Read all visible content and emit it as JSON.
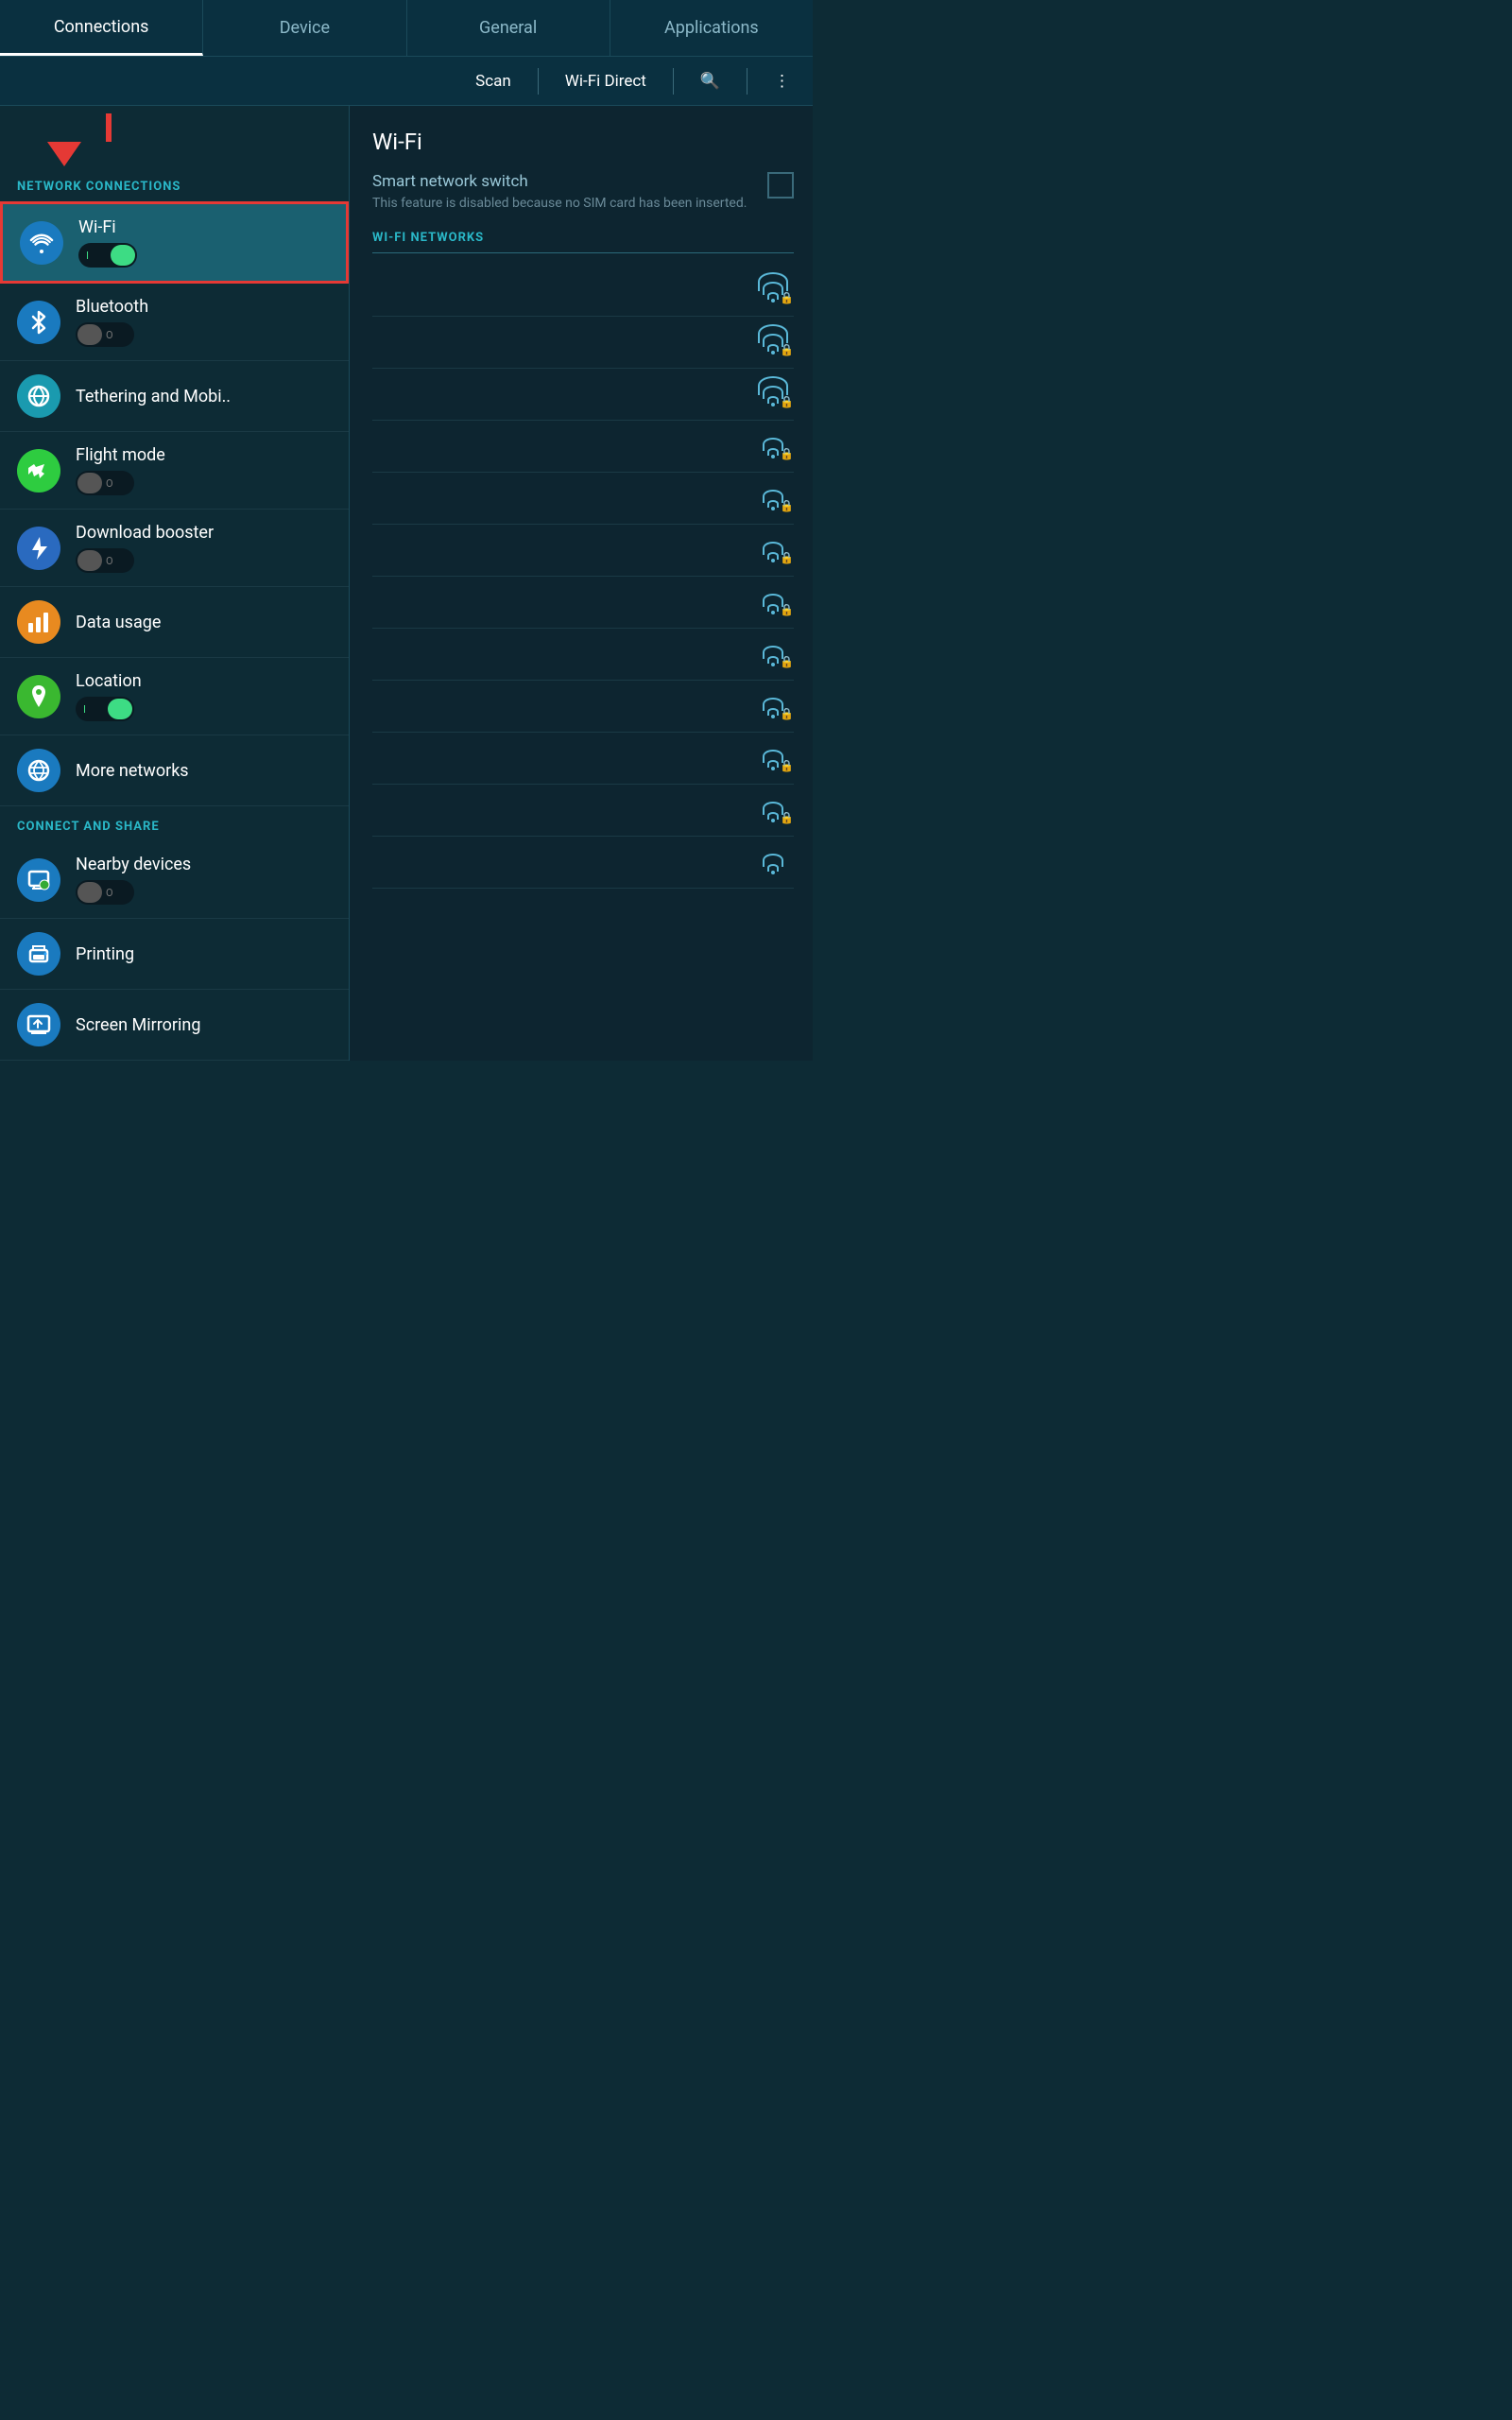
{
  "tabs": [
    {
      "id": "connections",
      "label": "Connections",
      "active": true
    },
    {
      "id": "device",
      "label": "Device",
      "active": false
    },
    {
      "id": "general",
      "label": "General",
      "active": false
    },
    {
      "id": "applications",
      "label": "Applications",
      "active": false
    }
  ],
  "toolbar": {
    "scan_label": "Scan",
    "wifi_direct_label": "Wi-Fi Direct",
    "search_icon": "🔍",
    "more_icon": "⋮"
  },
  "sidebar": {
    "section1_label": "NETWORK CONNECTIONS",
    "section2_label": "CONNECT AND SHARE",
    "items": [
      {
        "id": "wifi",
        "label": "Wi-Fi",
        "icon": "📶",
        "icon_class": "icon-blue",
        "has_toggle": true,
        "toggle_on": true,
        "selected": true
      },
      {
        "id": "bluetooth",
        "label": "Bluetooth",
        "icon": "🔵",
        "icon_class": "icon-blue",
        "has_toggle": true,
        "toggle_on": false
      },
      {
        "id": "tethering",
        "label": "Tethering and Mobi..",
        "icon": "📡",
        "icon_class": "icon-teal",
        "has_toggle": false
      },
      {
        "id": "flight",
        "label": "Flight mode",
        "icon": "✈",
        "icon_class": "icon-green",
        "has_toggle": true,
        "toggle_on": false
      },
      {
        "id": "download",
        "label": "Download booster",
        "icon": "⚡",
        "icon_class": "icon-lightning",
        "has_toggle": true,
        "toggle_on": false
      },
      {
        "id": "data_usage",
        "label": "Data usage",
        "icon": "📊",
        "icon_class": "icon-orange",
        "has_toggle": false
      },
      {
        "id": "location",
        "label": "Location",
        "icon": "📍",
        "icon_class": "icon-mappin",
        "has_toggle": true,
        "toggle_on": true
      },
      {
        "id": "more_networks",
        "label": "More networks",
        "icon": "🌐",
        "icon_class": "icon-globe",
        "has_toggle": false
      }
    ],
    "items2": [
      {
        "id": "nearby",
        "label": "Nearby devices",
        "icon": "🖨",
        "icon_class": "icon-nearby",
        "has_toggle": true,
        "toggle_on": false
      },
      {
        "id": "printing",
        "label": "Printing",
        "icon": "🖨",
        "icon_class": "icon-print",
        "has_toggle": false
      },
      {
        "id": "mirroring",
        "label": "Screen Mirroring",
        "icon": "📺",
        "icon_class": "icon-mirror",
        "has_toggle": false
      }
    ]
  },
  "content": {
    "title": "Wi-Fi",
    "smart_switch_label": "Smart network switch",
    "smart_switch_sub": "This feature is disabled because no SIM card has been inserted.",
    "wifi_networks_label": "WI-FI NETWORKS",
    "networks_count": 12
  }
}
